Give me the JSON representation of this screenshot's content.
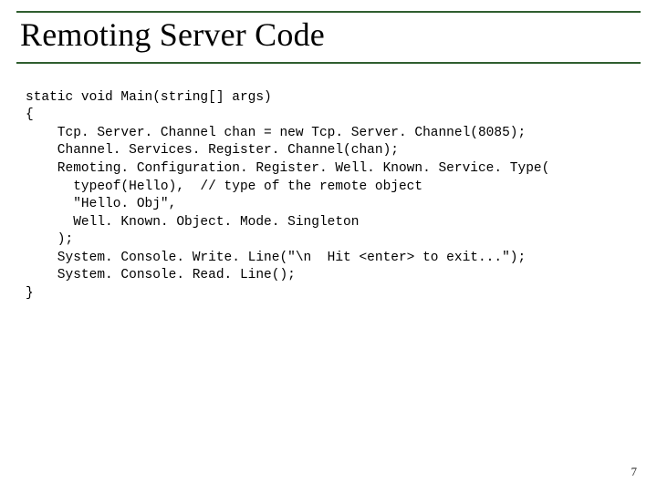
{
  "slide": {
    "title": "Remoting Server Code",
    "page_number": "7",
    "code": "static void Main(string[] args)\n{\n    Tcp. Server. Channel chan = new Tcp. Server. Channel(8085);\n    Channel. Services. Register. Channel(chan);\n    Remoting. Configuration. Register. Well. Known. Service. Type(\n      typeof(Hello),  // type of the remote object\n      \"Hello. Obj\",\n      Well. Known. Object. Mode. Singleton\n    );\n    System. Console. Write. Line(\"\\n  Hit <enter> to exit...\");\n    System. Console. Read. Line();\n}"
  }
}
